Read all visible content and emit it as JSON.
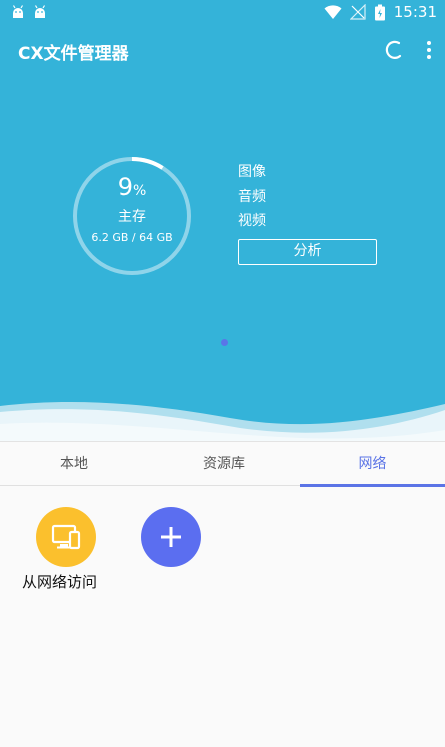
{
  "status_bar": {
    "time": "15:31"
  },
  "app_bar": {
    "title": "CX文件管理器"
  },
  "storage": {
    "percent": "9",
    "percent_symbol": "%",
    "used_fraction": 0.09,
    "label": "主存",
    "size": "6.2 GB / 64 GB"
  },
  "categories": [
    "图像",
    "音频",
    "视频"
  ],
  "analyze_label": "分析",
  "tabs": [
    {
      "label": "本地",
      "active": false
    },
    {
      "label": "资源库",
      "active": false
    },
    {
      "label": "网络",
      "active": true
    }
  ],
  "network": {
    "access_label": "从网络访问"
  },
  "colors": {
    "hero_bg": "#34b3d9",
    "accent": "#5b74e6",
    "access_icon_bg": "#fbc02d",
    "add_button_bg": "#5b6ef0"
  }
}
